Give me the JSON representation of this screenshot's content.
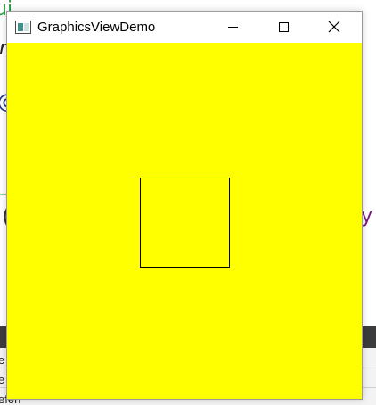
{
  "background": {
    "fragment_green": "ui",
    "fragment_r": "r",
    "fragment_at": "@",
    "fragment_dash": "_",
    "fragment_paren": "(",
    "fragment_y": "y",
    "bottom_line_1": "e",
    "bottom_line_2": "e",
    "bottom_line_3": "eferl"
  },
  "window": {
    "title": "GraphicsViewDemo",
    "icon": "app-window-icon",
    "controls": [
      "minimize-icon",
      "maximize-icon",
      "close-icon"
    ]
  },
  "graphics_view": {
    "background_color": "#ffff00",
    "items": [
      {
        "type": "rect",
        "stroke": "#000000",
        "fill": "none"
      }
    ]
  }
}
